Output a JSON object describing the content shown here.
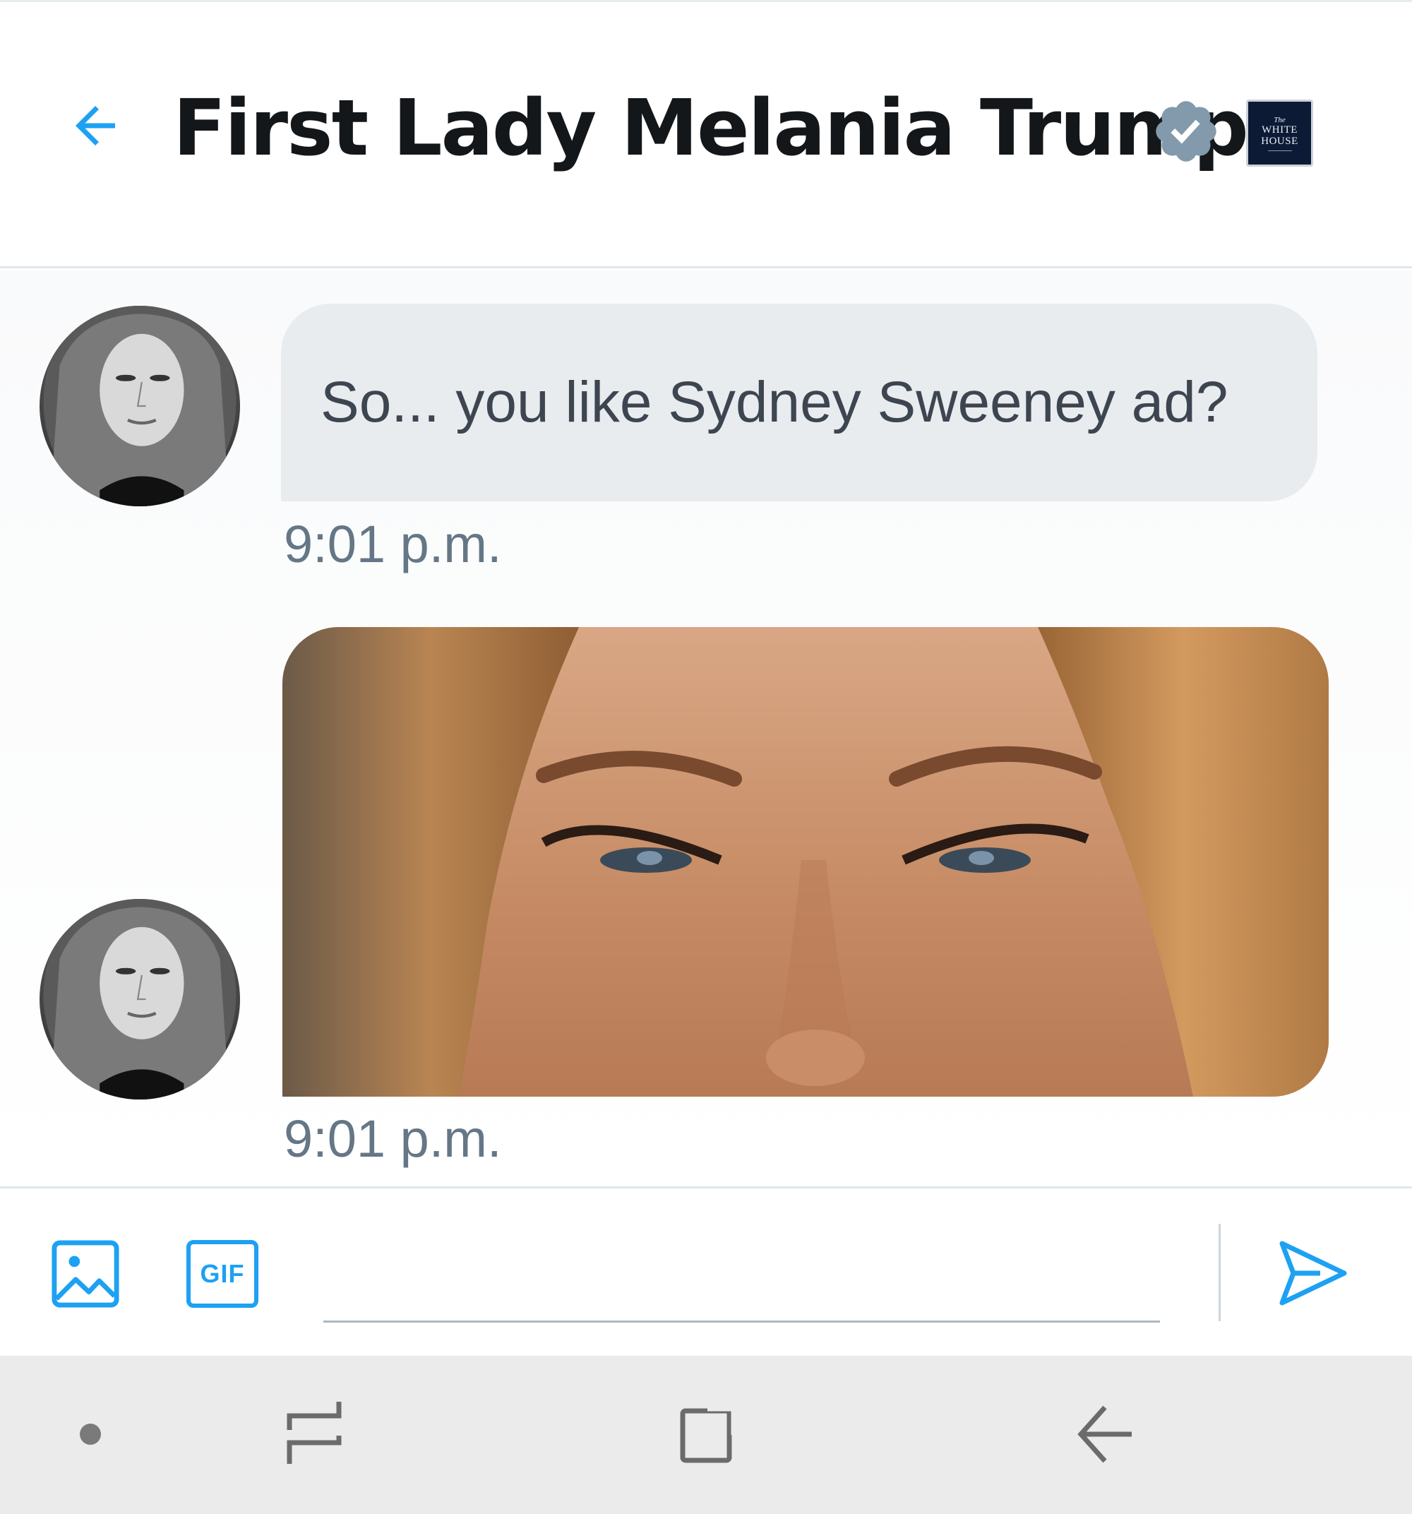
{
  "header": {
    "title": "First Lady Melania Trump",
    "badge": {
      "line1": "The",
      "line2": "WHITE",
      "line3": "HOUSE"
    }
  },
  "messages": [
    {
      "type": "text",
      "text": "So... you like Sydney Sweeney ad?",
      "time": "9:01 p.m."
    },
    {
      "type": "image",
      "time": "9:01 p.m."
    }
  ],
  "composer": {
    "gif_label": "GIF",
    "input_value": "",
    "input_placeholder": ""
  },
  "colors": {
    "accent": "#1da1f2",
    "verified": "#829aab",
    "bubble": "#e9ecef",
    "title": "#14171a",
    "timestamp": "#657786",
    "navbar": "#ebebeb"
  },
  "icons": [
    "back-arrow-icon",
    "verified-badge-icon",
    "white-house-logo",
    "image-icon",
    "gif-icon",
    "send-icon",
    "nav-dot-icon",
    "recent-apps-icon",
    "home-icon",
    "nav-back-icon"
  ]
}
